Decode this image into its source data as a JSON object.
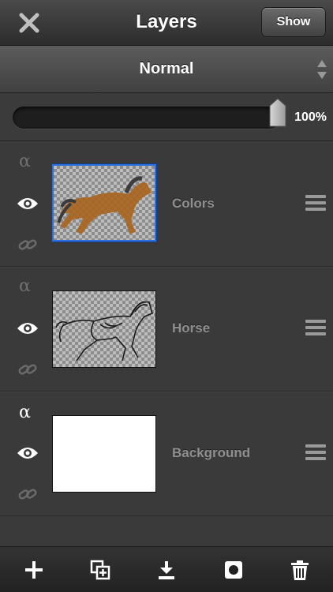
{
  "header": {
    "title": "Layers",
    "show_label": "Show",
    "close_icon": "close-icon"
  },
  "blend": {
    "mode": "Normal"
  },
  "opacity": {
    "value_label": "100%",
    "value": 1.0
  },
  "layers": [
    {
      "name": "Colors",
      "selected": true,
      "visible": true,
      "alpha_locked": false,
      "linked": false,
      "thumbnail": "brown horse on transparent"
    },
    {
      "name": "Horse",
      "selected": false,
      "visible": true,
      "alpha_locked": false,
      "linked": false,
      "thumbnail": "sketched horse on transparent"
    },
    {
      "name": "Background",
      "selected": false,
      "visible": true,
      "alpha_locked": true,
      "linked": false,
      "thumbnail": "white"
    }
  ],
  "toolbar": {
    "icons": [
      "add-layer-icon",
      "duplicate-layer-icon",
      "merge-down-icon",
      "mask-icon",
      "delete-icon"
    ]
  },
  "colors": {
    "selection": "#2b6fe0",
    "background": "#3a3a3a"
  }
}
